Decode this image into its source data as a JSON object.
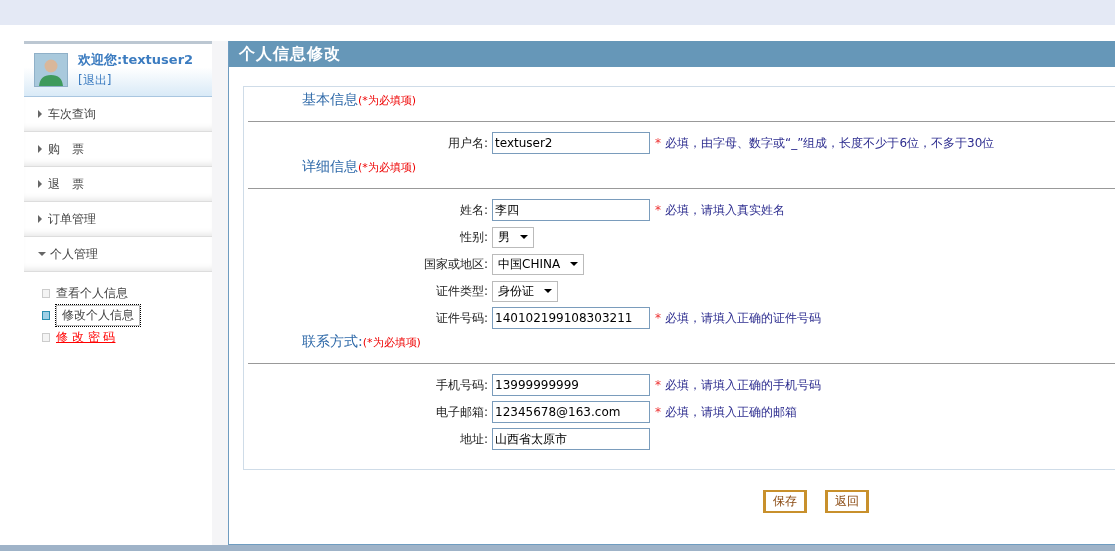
{
  "user": {
    "welcome": "欢迎您:textuser2",
    "logout": "[退出]"
  },
  "menu": [
    {
      "label": "车次查询",
      "expanded": false
    },
    {
      "label": "购　票",
      "expanded": false
    },
    {
      "label": "退　票",
      "expanded": false
    },
    {
      "label": "订单管理",
      "expanded": false
    },
    {
      "label": "个人管理",
      "expanded": true,
      "children": [
        {
          "label": "查看个人信息",
          "selected": false,
          "hovered": false
        },
        {
          "label": "修改个人信息",
          "selected": true,
          "hovered": false
        },
        {
          "label": "修 改 密 码",
          "selected": false,
          "hovered": true
        }
      ]
    }
  ],
  "panel": {
    "title": "个人信息修改"
  },
  "sections": [
    {
      "title": "基本信息",
      "note": "(*为必填项)",
      "rows": [
        {
          "label": "用户名:",
          "kind": "input",
          "value": "textuser2",
          "hint_mark": "*",
          "hint": "必填，由字母、数字或“_”组成，长度不少于6位，不多于30位"
        }
      ]
    },
    {
      "title": "详细信息",
      "note": "(*为必填项)",
      "rows": [
        {
          "label": "姓名:",
          "kind": "input",
          "value": "李四",
          "hint_mark": "*",
          "hint": "必填，请填入真实姓名"
        },
        {
          "label": "性别:",
          "kind": "select",
          "value": "男"
        },
        {
          "label": "国家或地区:",
          "kind": "select",
          "value": "中国CHINA"
        },
        {
          "label": "证件类型:",
          "kind": "select",
          "value": "身份证"
        },
        {
          "label": "证件号码:",
          "kind": "input",
          "value": "140102199108303211",
          "hint_mark": "*",
          "hint": "必填，请填入正确的证件号码"
        }
      ]
    },
    {
      "title": "联系方式:",
      "note": "(*为必填项)",
      "rows": [
        {
          "label": "手机号码:",
          "kind": "input",
          "value": "13999999999",
          "hint_mark": "*",
          "hint": "必填，请填入正确的手机号码"
        },
        {
          "label": "电子邮箱:",
          "kind": "input",
          "value": "12345678@163.com",
          "hint_mark": "*",
          "hint": "必填，请填入正确的邮箱"
        },
        {
          "label": "地址:",
          "kind": "input",
          "value": "山西省太原市"
        }
      ]
    }
  ],
  "buttons": [
    "保存",
    "返回"
  ]
}
